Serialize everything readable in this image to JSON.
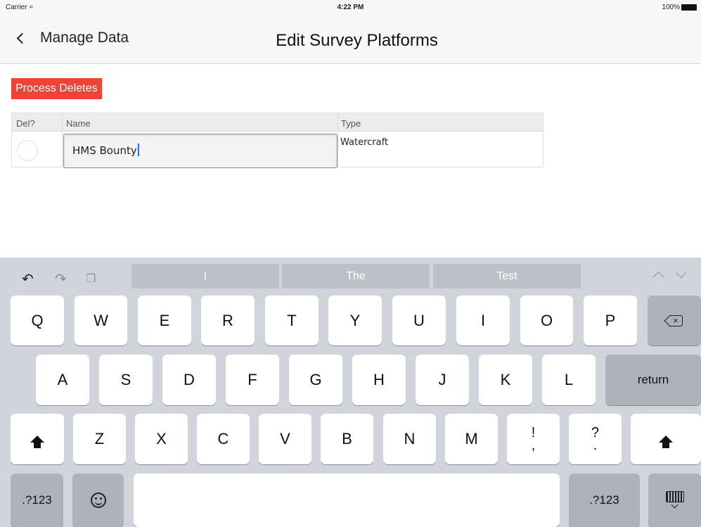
{
  "status_bar": {
    "carrier": "Carrier",
    "time": "4:22 PM",
    "battery": "100%"
  },
  "nav": {
    "back_label": "Manage Data",
    "title": "Edit Survey Platforms"
  },
  "actions": {
    "process_deletes": "Process Deletes"
  },
  "grid": {
    "columns": [
      "Del?",
      "Name",
      "Type"
    ],
    "rows": [
      {
        "name": "HMS Bounty",
        "type": "Watercraft"
      }
    ]
  },
  "keyboard": {
    "suggestions": [
      "I",
      "The",
      "Test"
    ],
    "row1": [
      "Q",
      "W",
      "E",
      "R",
      "T",
      "Y",
      "U",
      "I",
      "O",
      "P"
    ],
    "row2": [
      "A",
      "S",
      "D",
      "F",
      "G",
      "H",
      "J",
      "K",
      "L"
    ],
    "return_label": "return",
    "row3": [
      "Z",
      "X",
      "C",
      "V",
      "B",
      "N",
      "M"
    ],
    "punct1": {
      "top": "!",
      "bottom": ","
    },
    "punct2": {
      "top": "?",
      "bottom": "."
    },
    "numbers_label": ".?123"
  },
  "colors": {
    "accent_red": "#ee4336",
    "keyboard_bg": "#d1d5db",
    "caret": "#1a6fff"
  }
}
